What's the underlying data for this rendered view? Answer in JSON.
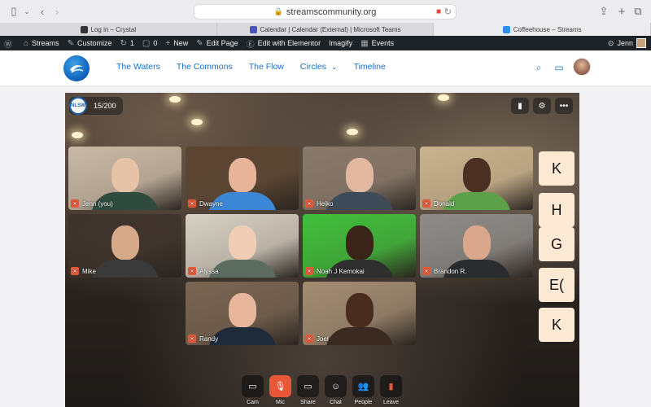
{
  "browser": {
    "url": "streamscommunity.org",
    "tabs": [
      {
        "label": "Log in – Crystal",
        "fav_color": "#333333",
        "active": false
      },
      {
        "label": "Calendar | Calendar (External) | Microsoft Teams",
        "fav_color": "#4b53bc",
        "active": false
      },
      {
        "label": "Coffeehouse – Streams",
        "fav_color": "#2d8fe6",
        "active": true
      }
    ]
  },
  "adminbar": {
    "items": [
      {
        "icon": "wordpress-icon",
        "glyph": "Ⓦ",
        "label": ""
      },
      {
        "icon": "home-icon",
        "glyph": "⌂",
        "label": "Streams"
      },
      {
        "icon": "brush-icon",
        "glyph": "✎",
        "label": "Customize"
      },
      {
        "icon": "updates-icon",
        "glyph": "↻",
        "label": "1"
      },
      {
        "icon": "comments-icon",
        "glyph": "▢",
        "label": "0"
      },
      {
        "icon": "plus-icon",
        "glyph": "+",
        "label": "New"
      },
      {
        "icon": "edit-icon",
        "glyph": "✎",
        "label": "Edit Page"
      },
      {
        "icon": "elementor-icon",
        "glyph": "Ⓔ",
        "label": "Edit with Elementor"
      },
      {
        "icon": "",
        "glyph": "",
        "label": "Imagify"
      },
      {
        "icon": "events-icon",
        "glyph": "▦",
        "label": "Events"
      }
    ],
    "user_label": "Jenn"
  },
  "nav": {
    "items": [
      "The Waters",
      "The Commons",
      "The Flow",
      "Circles",
      "Timeline"
    ],
    "dropdown_caret": "⌄"
  },
  "room": {
    "logo_text": "NLSW",
    "count": "15/200"
  },
  "participants": [
    {
      "name": "Jenn (you)",
      "bg": "#c9b9a6",
      "skin": "#e6c2a6",
      "shirt": "#2f4a3f"
    },
    {
      "name": "Dwayne",
      "bg": "#5b4431",
      "skin": "#e7b49a",
      "shirt": "#3b87d6"
    },
    {
      "name": "Heiko",
      "bg": "#8a7a6c",
      "skin": "#e2b8a0",
      "shirt": "#3d4a58"
    },
    {
      "name": "Donald",
      "bg": "#c9b38d",
      "skin": "#4a2f22",
      "shirt": "#5ca04a"
    },
    {
      "name": "Mike",
      "bg": "#3e332b",
      "skin": "#d6a98b",
      "shirt": "#3a3a3a"
    },
    {
      "name": "Alyssa",
      "bg": "#d7d0c4",
      "skin": "#f0cdb5",
      "shirt": "#5b6b60"
    },
    {
      "name": "Noah J Kemokai",
      "bg": "#3fbf3a",
      "skin": "#3a2419",
      "shirt": "#2f2f2f"
    },
    {
      "name": "Brandon R.",
      "bg": "#8d8a88",
      "skin": "#d9a88c",
      "shirt": "#2a2c30"
    },
    {
      "name": "Randy",
      "bg": "#7a6552",
      "skin": "#e8b69d",
      "shirt": "#1f2a3a"
    },
    {
      "name": "Joel",
      "bg": "#a38c72",
      "skin": "#4a2c1e",
      "shirt": "#3a2a22"
    }
  ],
  "letters": [
    "K",
    "H",
    "G",
    "E(",
    "K"
  ],
  "controls": [
    {
      "label": "Cam",
      "glyph": "▭",
      "icon": "camera-icon",
      "red": false
    },
    {
      "label": "Mic",
      "glyph": "🎙",
      "icon": "mic-muted-icon",
      "red": true
    },
    {
      "label": "Share",
      "glyph": "▭",
      "icon": "share-screen-icon",
      "red": false
    },
    {
      "label": "Chat",
      "glyph": "☺",
      "icon": "chat-icon",
      "red": false
    },
    {
      "label": "People",
      "glyph": "👥",
      "icon": "people-icon",
      "red": false
    },
    {
      "label": "Leave",
      "glyph": "▮",
      "icon": "leave-icon",
      "red": false
    }
  ]
}
